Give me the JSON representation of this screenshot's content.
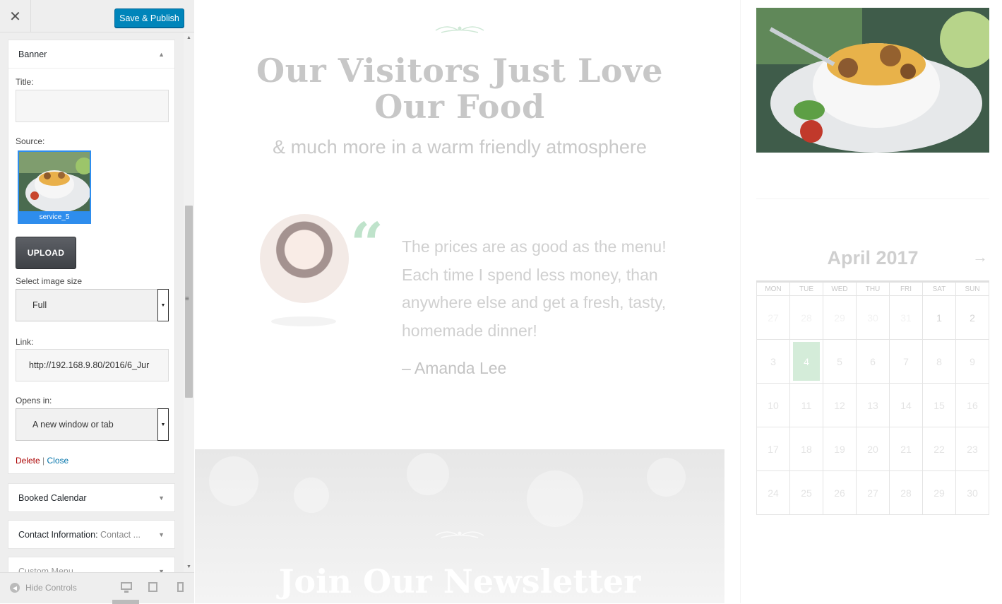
{
  "topbar": {
    "close_glyph": "✕",
    "publish_label": "Save & Publish"
  },
  "banner_widget": {
    "title": "Banner",
    "title_label": "Title:",
    "title_value": "",
    "source_label": "Source:",
    "image_caption": "service_5",
    "upload_label": "UPLOAD",
    "size_label": "Select image size",
    "size_value": "Full",
    "link_label": "Link:",
    "link_value": "http://192.168.9.80/2016/6_Jur",
    "opens_label": "Opens in:",
    "opens_value": "A new window or tab",
    "delete_label": "Delete",
    "separator": "|",
    "close_label": "Close"
  },
  "widgets": {
    "booked": "Booked Calendar",
    "contact_prefix": "Contact Information:",
    "contact_sub": "Contact ...",
    "custom": "Custom Menu"
  },
  "footer": {
    "hide_controls": "Hide Controls"
  },
  "preview": {
    "heading": "Our Visitors Just Love Our Food",
    "subheading": "& much more in a warm friendly atmosphere",
    "quote_mark": "“",
    "quote": "The prices are as good as the menu! Each time I spend less money, than anywhere else and get a fresh, tasty, homemade dinner!",
    "author": "– Amanda Lee",
    "newsletter_title": "Join Our Newsletter"
  },
  "calendar": {
    "title": "April 2017",
    "next_glyph": "→",
    "days": [
      "MON",
      "TUE",
      "WED",
      "THU",
      "FRI",
      "SAT",
      "SUN"
    ],
    "weeks": [
      [
        "27",
        "28",
        "29",
        "30",
        "31",
        "1",
        "2"
      ],
      [
        "3",
        "4",
        "5",
        "6",
        "7",
        "8",
        "9"
      ],
      [
        "10",
        "11",
        "12",
        "13",
        "14",
        "15",
        "16"
      ],
      [
        "17",
        "18",
        "19",
        "20",
        "21",
        "22",
        "23"
      ],
      [
        "24",
        "25",
        "26",
        "27",
        "28",
        "29",
        "30"
      ]
    ],
    "today": "4"
  },
  "colors": {
    "primary": "#0085ba",
    "link": "#0073aa",
    "delete": "#aa0000",
    "today_bg": "#d4ecd9",
    "quote_mark": "#bfe3cb"
  }
}
